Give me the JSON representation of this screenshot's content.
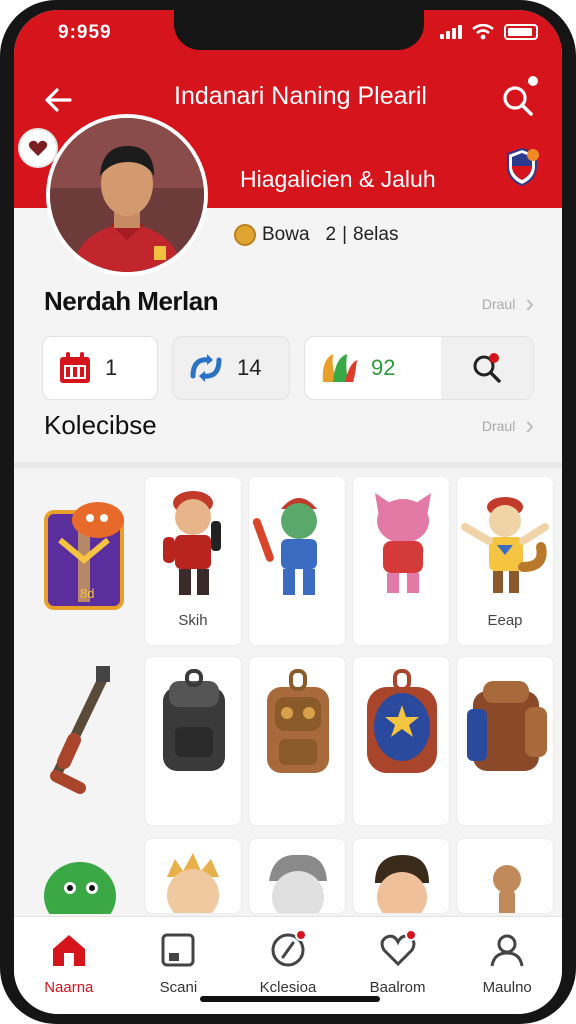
{
  "status": {
    "time": "9:959"
  },
  "header": {
    "title": "Indanari Naning Plearil",
    "subtitle": "Hiagalicien & Jaluh"
  },
  "profile": {
    "currency_label": "Bowa",
    "count": "2",
    "separator": "|",
    "suffix": "8elas",
    "name": "Nerdah Merlan",
    "more_label": "Draul"
  },
  "quick_stats": [
    {
      "icon": "calendar-icon",
      "value": "1"
    },
    {
      "icon": "refresh-icon",
      "value": "14"
    },
    {
      "icon": "leaf-icon",
      "value": "92"
    }
  ],
  "collection": {
    "title": "Kolecibse",
    "more_label": "Draul",
    "items": [
      {
        "name": "jersey-shirt",
        "label": ""
      },
      {
        "name": "soldier-figure",
        "label": "Skih"
      },
      {
        "name": "goblin-figure",
        "label": ""
      },
      {
        "name": "pink-cat-figure",
        "label": ""
      },
      {
        "name": "fox-figure",
        "label": "Eeap"
      },
      {
        "name": "rifle",
        "label": ""
      },
      {
        "name": "black-backpack",
        "label": ""
      },
      {
        "name": "brown-backpack",
        "label": ""
      },
      {
        "name": "blue-backpack",
        "label": ""
      },
      {
        "name": "rolled-backpack",
        "label": ""
      },
      {
        "name": "green-blob",
        "label": ""
      },
      {
        "name": "spiky-hair-head",
        "label": ""
      },
      {
        "name": "grey-hair-head",
        "label": ""
      },
      {
        "name": "brown-hair-head",
        "label": ""
      },
      {
        "name": "wooden-figure",
        "label": ""
      }
    ]
  },
  "tabs": [
    {
      "label": "Naarna",
      "icon": "home-icon",
      "active": true
    },
    {
      "label": "Scani",
      "icon": "card-icon",
      "active": false
    },
    {
      "label": "Kclesioa",
      "icon": "compass-icon",
      "active": false
    },
    {
      "label": "Baalrom",
      "icon": "heart-icon",
      "active": false
    },
    {
      "label": "Maulno",
      "icon": "user-icon",
      "active": false
    }
  ],
  "colors": {
    "brand": "#d5141c",
    "background": "#f4f4f4"
  }
}
